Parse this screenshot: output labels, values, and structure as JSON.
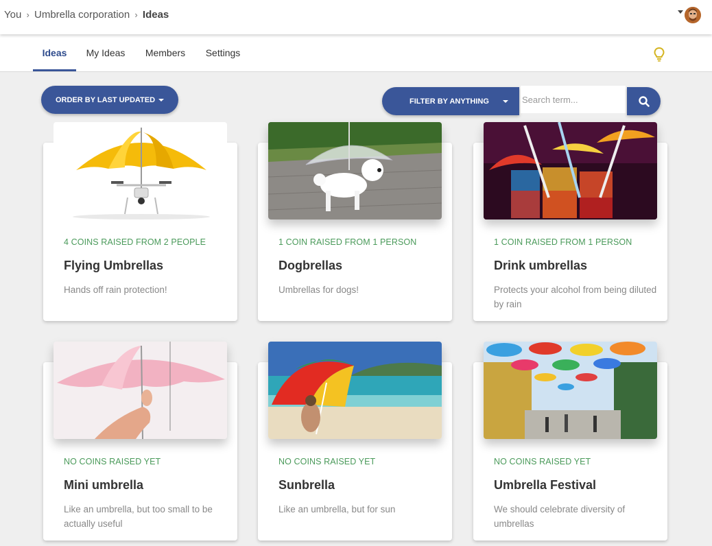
{
  "breadcrumb": {
    "you": "You",
    "sep": "›",
    "org": "Umbrella corporation",
    "current": "Ideas"
  },
  "tabs": [
    {
      "label": "Ideas",
      "active": true
    },
    {
      "label": "My Ideas",
      "active": false
    },
    {
      "label": "Members",
      "active": false
    },
    {
      "label": "Settings",
      "active": false
    }
  ],
  "controls": {
    "order_label": "ORDER BY LAST UPDATED",
    "filter_label": "FILTER BY ANYTHING",
    "search_placeholder": "Search term...",
    "search_value": ""
  },
  "ideas": [
    {
      "coins": "4 COINS RAISED FROM 2 PEOPLE",
      "title": "Flying Umbrellas",
      "description": "Hands off rain protection!",
      "image": "drone-umbrella"
    },
    {
      "coins": "1 COIN RAISED FROM 1 PERSON",
      "title": "Dogbrellas",
      "description": "Umbrellas for dogs!",
      "image": "dog-umbrella"
    },
    {
      "coins": "1 COIN RAISED FROM 1 PERSON",
      "title": "Drink umbrellas",
      "description": "Protects your alcohol from being diluted by rain",
      "image": "cocktail-umbrellas"
    },
    {
      "coins": "NO COINS RAISED YET",
      "title": "Mini umbrella",
      "description": "Like an umbrella, but too small to be actually useful",
      "image": "mini-umbrella"
    },
    {
      "coins": "NO COINS RAISED YET",
      "title": "Sunbrella",
      "description": "Like an umbrella, but for sun",
      "image": "beach-umbrella"
    },
    {
      "coins": "NO COINS RAISED YET",
      "title": "Umbrella Festival",
      "description": "We should celebrate diversity of umbrellas",
      "image": "umbrella-street"
    }
  ],
  "colors": {
    "primary": "#3a5699",
    "coins": "#4a9a5a",
    "bulb": "#d4b420"
  },
  "icons": {
    "bulb": "lightbulb-icon",
    "search": "search-icon",
    "user": "avatar"
  }
}
